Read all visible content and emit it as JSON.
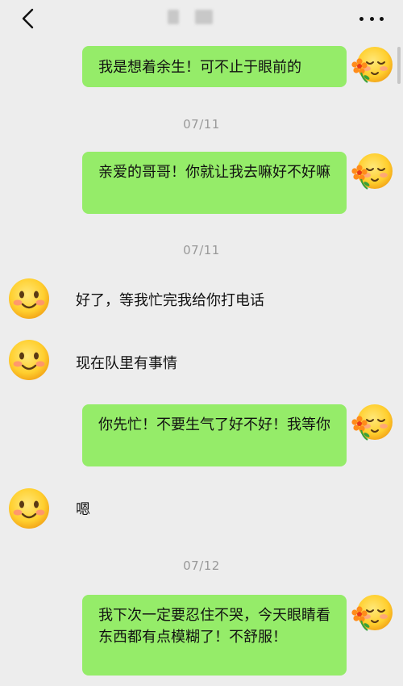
{
  "header": {
    "back_icon": "chevron-left-icon",
    "more_icon": "more-dots-icon"
  },
  "messages": [
    {
      "side": "right",
      "text": "我是想着余生！可不止于眼前的"
    },
    {
      "type": "date",
      "text": "07/11"
    },
    {
      "side": "right",
      "text": "亲爱的哥哥！你就让我去嘛好不好嘛"
    },
    {
      "type": "date",
      "text": "07/11"
    },
    {
      "side": "left",
      "text": "好了，等我忙完我给你打电话"
    },
    {
      "side": "left",
      "text": "现在队里有事情"
    },
    {
      "side": "right",
      "text": "你先忙！不要生气了好不好！我等你"
    },
    {
      "side": "left",
      "text": "嗯"
    },
    {
      "type": "date",
      "text": "07/12"
    },
    {
      "side": "right",
      "text": "我下次一定要忍住不哭，今天眼睛看东西都有点模糊了！不舒服！"
    }
  ],
  "colors": {
    "background": "#ededed",
    "bubble_right": "#95ec69",
    "date_text": "#999999"
  },
  "avatars": {
    "right": "emoji-blush-with-flower-avatar",
    "left": "emoji-smile-avatar"
  }
}
